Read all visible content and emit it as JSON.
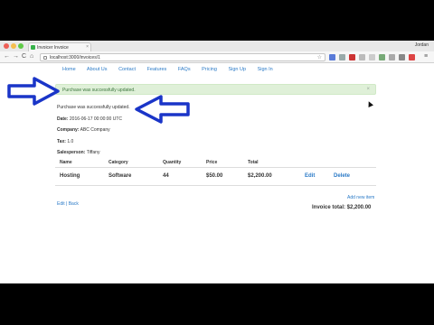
{
  "browser": {
    "tab_title": "Invoicer Invoice",
    "tab_close": "×",
    "user": "Jordan",
    "url": "localhost:3000/invoices/1",
    "back": "←",
    "forward": "→",
    "reload": "C",
    "home": "⌂",
    "star": "☆",
    "menu": "≡"
  },
  "nav": {
    "items": [
      "Home",
      "About Us",
      "Contact",
      "Features",
      "FAQs",
      "Pricing",
      "Sign Up",
      "Sign In"
    ]
  },
  "alert": {
    "message": "Purchase was successfully updated.",
    "close": "×"
  },
  "notice": "Purchase was successfully updated.",
  "details": {
    "date_label": "Date:",
    "date_value": "2016-06-17 00:00:00 UTC",
    "company_label": "Company:",
    "company_value": "ABC Company",
    "tax_label": "Tax:",
    "tax_value": "1.0",
    "salesperson_label": "Salesperson:",
    "salesperson_value": "Tiffany"
  },
  "table": {
    "headers": [
      "Name",
      "Category",
      "Quantity",
      "Price",
      "Total"
    ],
    "rows": [
      {
        "name": "Hosting",
        "category": "Software",
        "quantity": "44",
        "price": "$50.00",
        "total": "$2,200.00",
        "edit": "Edit",
        "delete": "Delete"
      }
    ]
  },
  "add_new_item": "Add new item",
  "invoice_total": "Invoice total: $2,200.00",
  "footer": {
    "edit": "Edit",
    "separator": "|",
    "back": "Back"
  },
  "colors": {
    "link": "#2a7ac7",
    "alert_bg": "#dff0d8",
    "arrow": "#1a35c8"
  }
}
